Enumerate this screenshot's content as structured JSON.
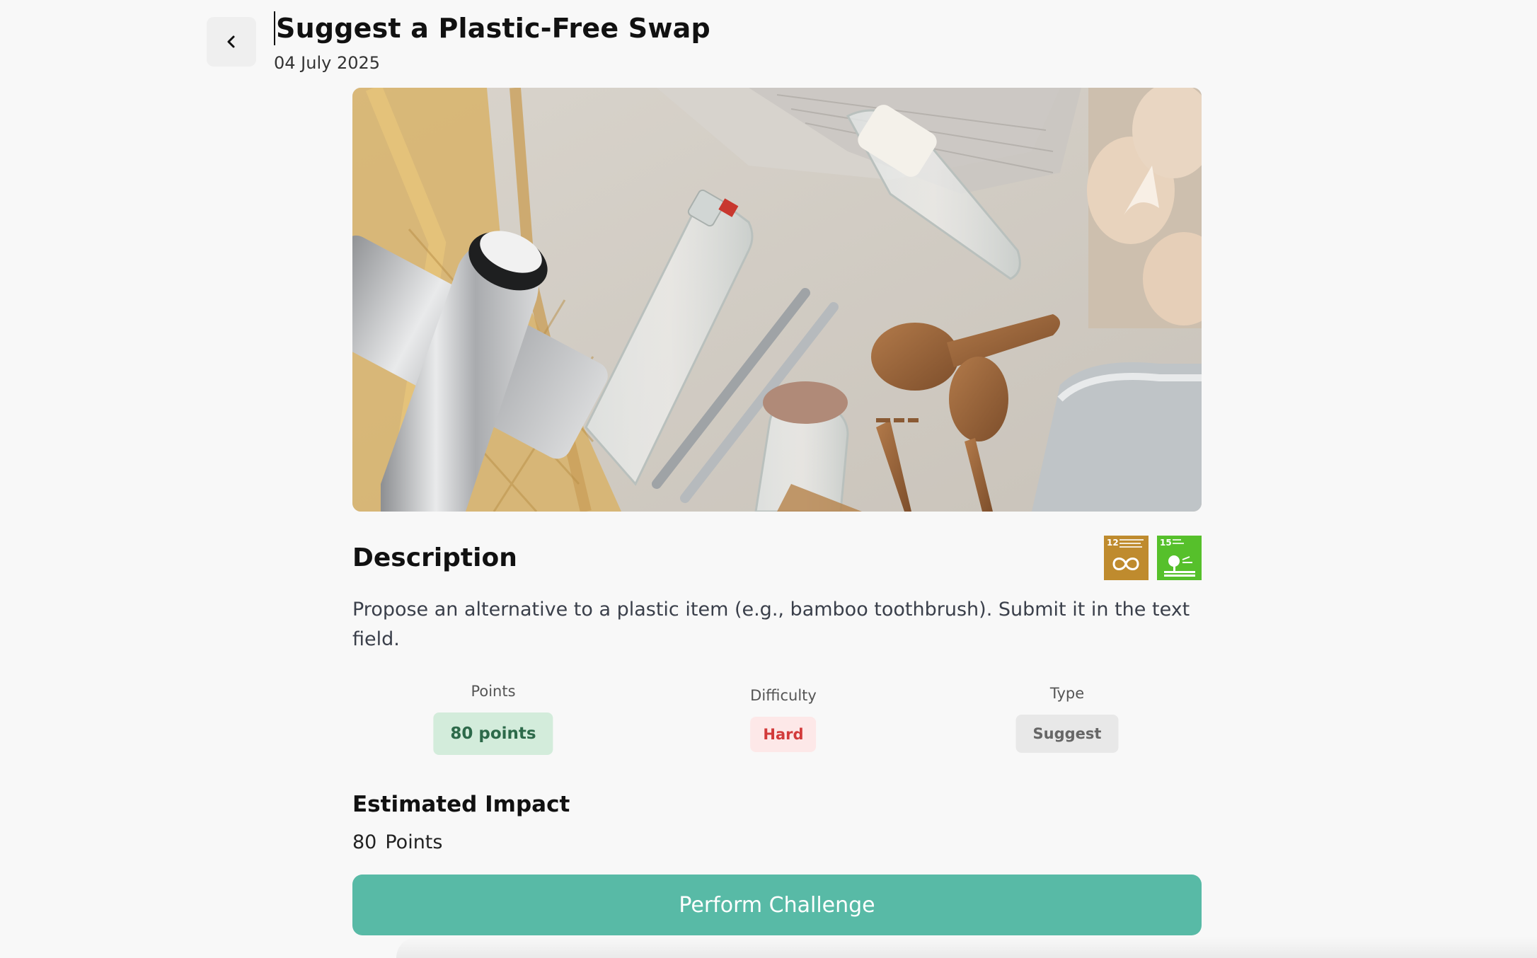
{
  "header": {
    "title": "Suggest a Plastic-Free Swap",
    "date": "04 July 2025"
  },
  "hero": {
    "alt": "Reusable stainless bottle, glass bottles, metal straws, wooden spoons, mesh bags and eggs"
  },
  "description": {
    "heading": "Description",
    "text": "Propose an alternative to a plastic item (e.g., bamboo toothbrush). Submit it in the text field.",
    "sdg_badges": [
      {
        "number": "12",
        "color": "#bf8b2e"
      },
      {
        "number": "15",
        "color": "#56c02b"
      }
    ]
  },
  "stats": {
    "points_label": "Points",
    "points_value": "80 points",
    "difficulty_label": "Difficulty",
    "difficulty_value": "Hard",
    "type_label": "Type",
    "type_value": "Suggest"
  },
  "impact": {
    "heading": "Estimated Impact",
    "value": "80",
    "unit": "Points"
  },
  "cta": {
    "label": "Perform Challenge"
  },
  "colors": {
    "accent": "#58baa6",
    "points_bg": "#d3ecdb",
    "hard_bg": "#fde8e8",
    "hard_text": "#d23a3a"
  }
}
